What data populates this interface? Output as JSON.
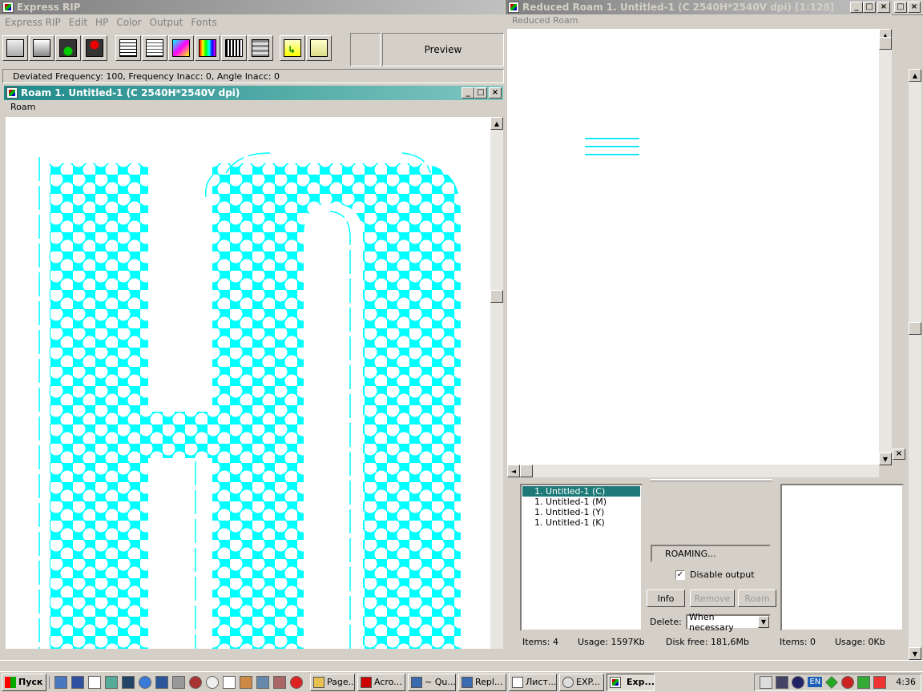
{
  "main_window": {
    "title": "Express RIP",
    "menu": [
      "Express RIP",
      "Edit",
      "HP",
      "Color",
      "Output",
      "Fonts"
    ],
    "toolbar_icons": [
      "open-file-icon",
      "print-file-icon",
      "traffic-light-green-icon",
      "traffic-light-red-icon",
      "document-icon",
      "clipboard-icon",
      "color-doc-icon",
      "color-bars-icon",
      "halftone-icon",
      "stack-icon",
      "page-setup-icon",
      "export-icon",
      "ruler-icon"
    ],
    "preview_label": "Preview",
    "status_text": "Deviated Frequency: 100, Frequency Inacc: 0, Angle Inacc: 0"
  },
  "roam_window": {
    "title": "Roam 1. Untitled-1  (C 2540H*2540V dpi)",
    "menu": "Roam",
    "halftone_color": "#00ffff"
  },
  "reduced_window": {
    "title": "Reduced Roam 1. Untitled-1  (C 2540H*2540V dpi)  [1:128]",
    "menu": "Reduced Roam"
  },
  "job_panel": {
    "items": [
      "1. Untitled-1 (C)",
      "1. Untitled-1 (M)",
      "1. Untitled-1 (Y)",
      "1. Untitled-1 (K)"
    ],
    "selected_index": 0,
    "status": "ROAMING...",
    "disable_output_label": "Disable output",
    "disable_output_checked": true,
    "info_button": "Info",
    "remove_button": "Remove",
    "roam_button": "Roam",
    "delete_label": "Delete:",
    "delete_value": "When necessary",
    "left_items": "Items:  4",
    "left_usage": "Usage: 1597Kb",
    "disk_free": "Disk free:  181,6Mb",
    "right_items": "Items:  0",
    "right_usage": "Usage: 0Kb"
  },
  "taskbar": {
    "start_label": "Пуск",
    "tasks": [
      "Page...",
      "Acro...",
      "~ Qu...",
      "Repl...",
      "Лист...",
      "EXP...",
      "Exp..."
    ],
    "active_task_index": 6,
    "clock": "4:36",
    "lang": "EN"
  }
}
